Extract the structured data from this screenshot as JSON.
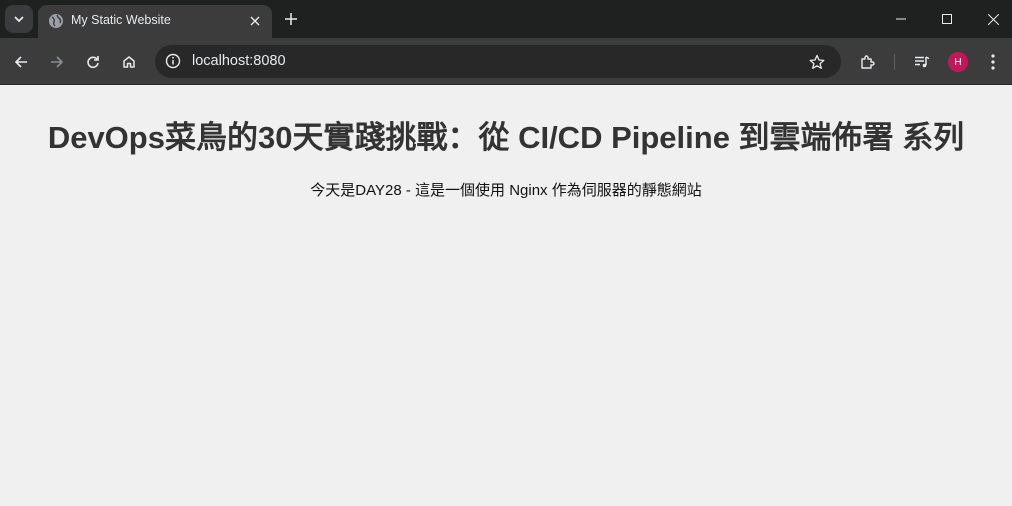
{
  "tab": {
    "title": "My Static Website"
  },
  "omnibox": {
    "url": "localhost:8080"
  },
  "profile": {
    "initial": "H",
    "color": "#c2185b"
  },
  "page": {
    "heading": "DevOps菜鳥的30天實踐挑戰：從 CI/CD Pipeline 到雲端佈署 系列",
    "description": "今天是DAY28 - 這是一個使用 Nginx 作為伺服器的靜態網站"
  },
  "icons": [
    "tab-search-icon",
    "globe-icon",
    "close-icon",
    "plus-icon",
    "minimize-icon",
    "maximize-icon",
    "window-close-icon",
    "back-icon",
    "forward-icon",
    "reload-icon",
    "home-icon",
    "info-icon",
    "star-icon",
    "extensions-icon",
    "media-icon",
    "menu-icon"
  ],
  "colors": {
    "page_background": "#f0f0f0",
    "heading": "#333333",
    "chrome_dark": "#1f2020",
    "toolbar": "#3c3c3c"
  }
}
